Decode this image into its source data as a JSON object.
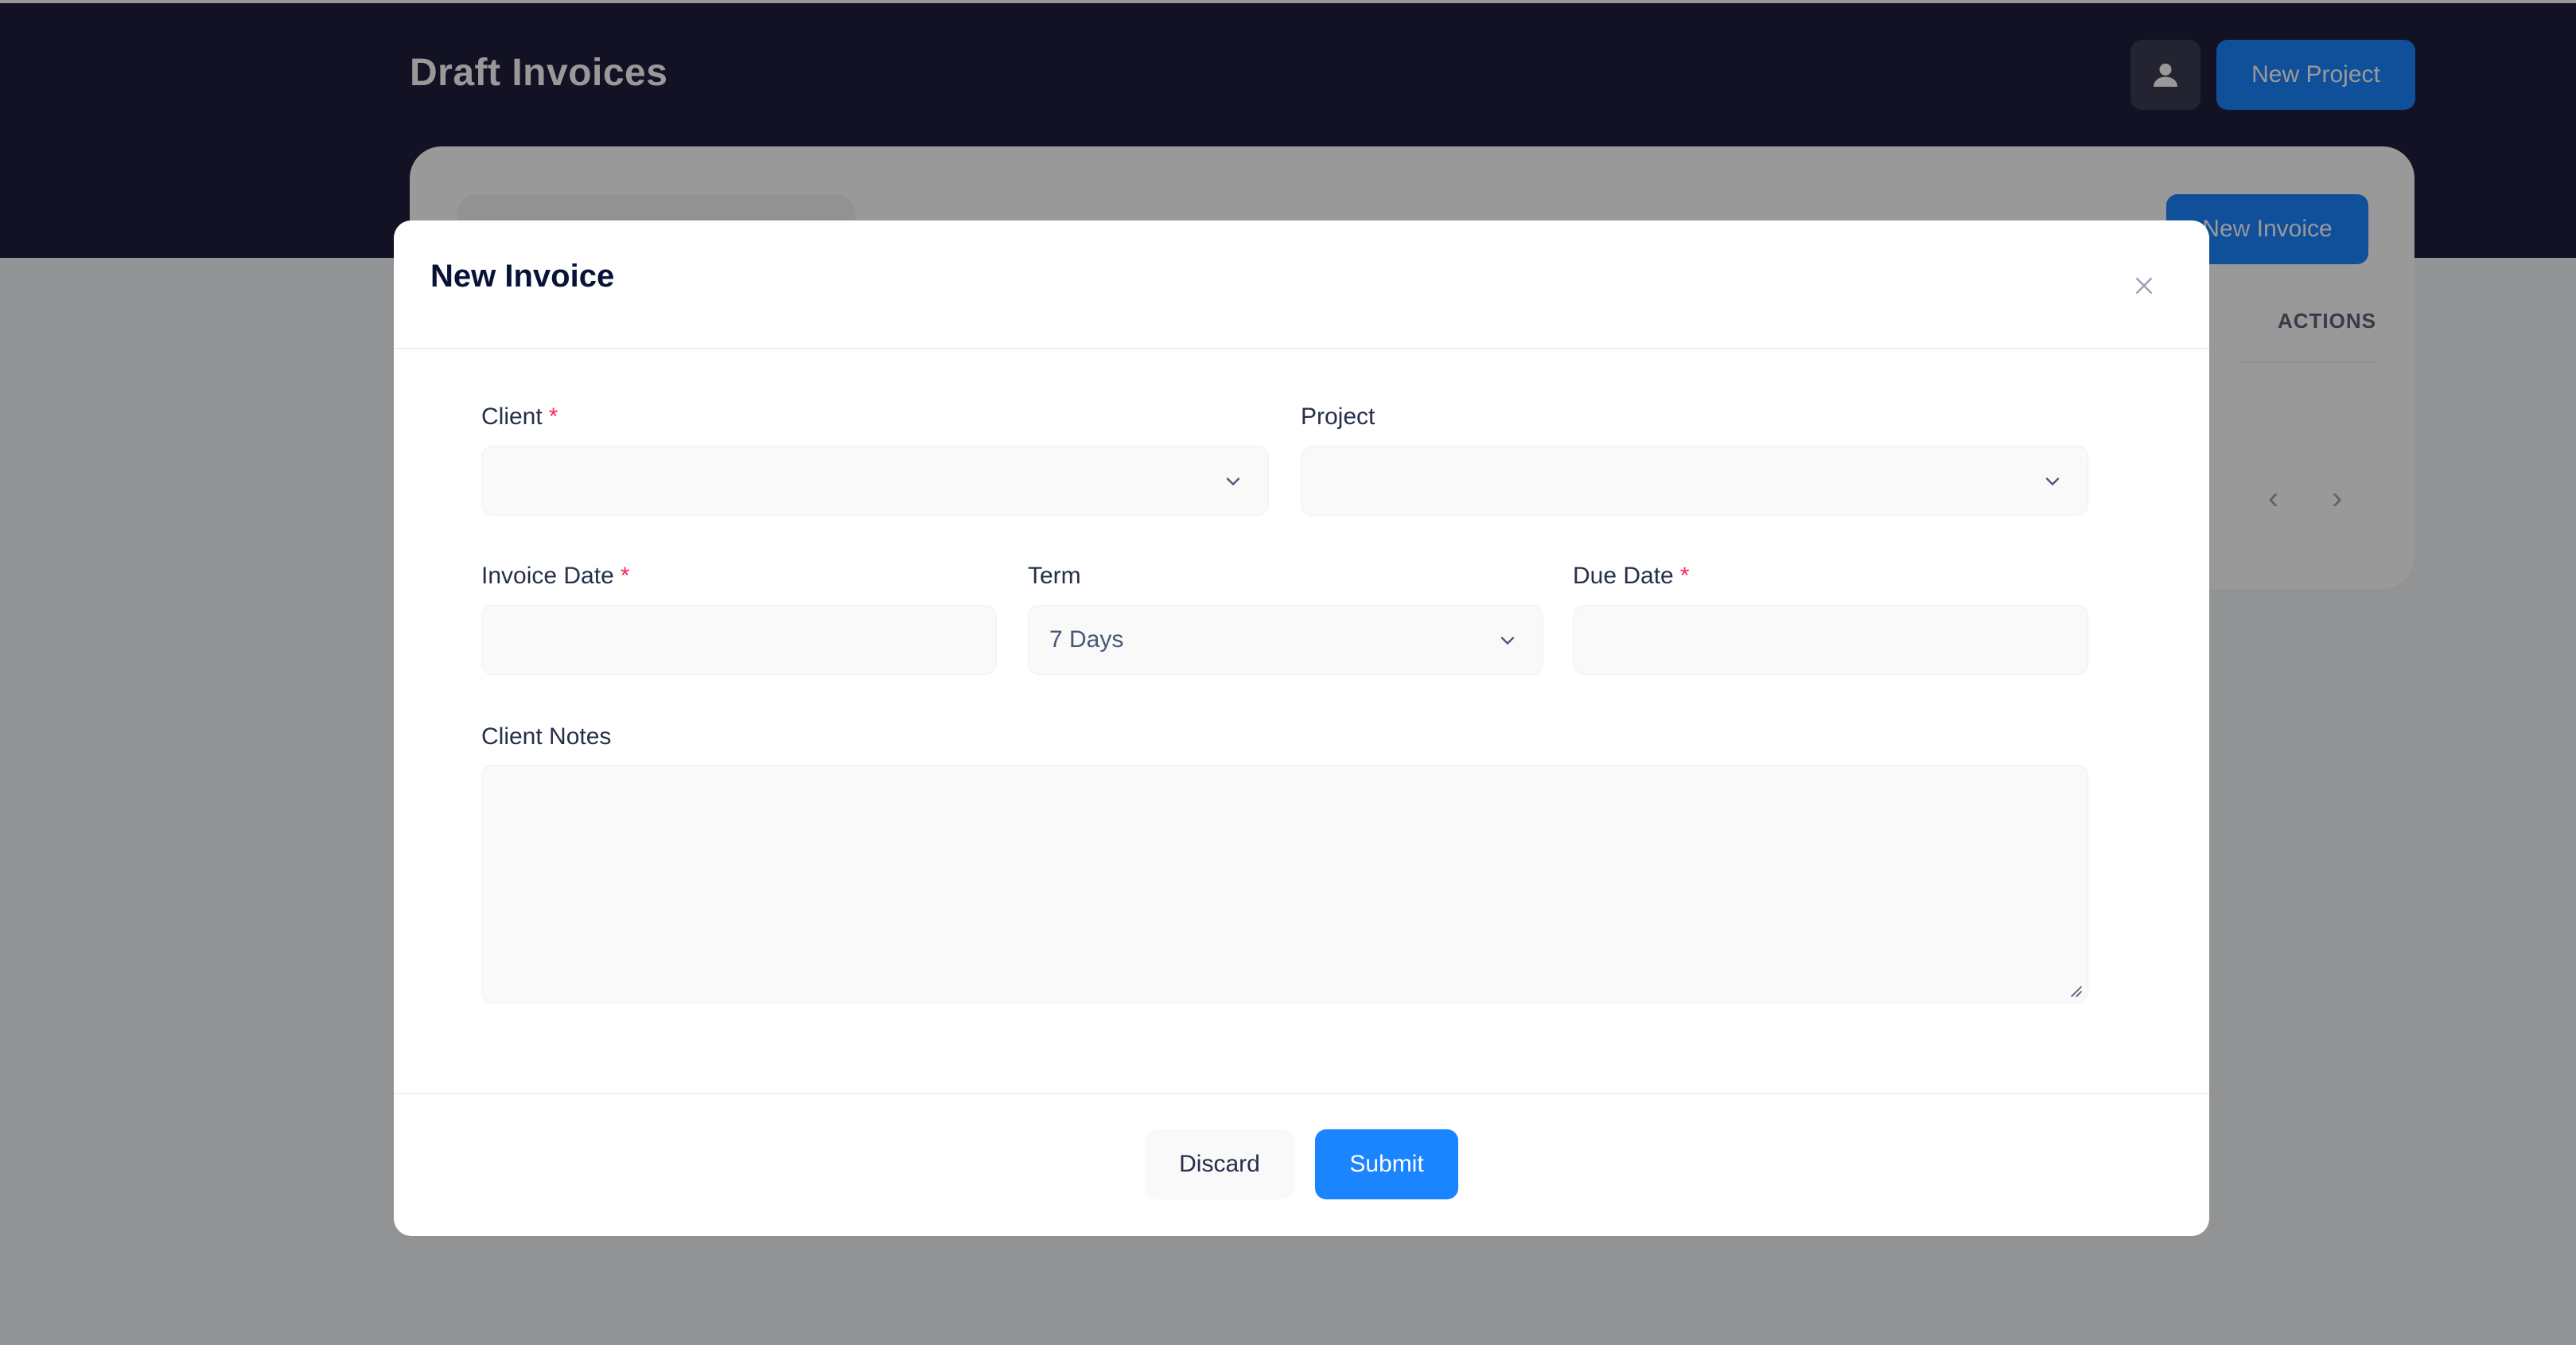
{
  "header": {
    "title": "Draft Invoices",
    "new_project_label": "New Project",
    "avatar_icon": "user-icon"
  },
  "background_card": {
    "new_invoice_label": "New Invoice",
    "actions_header": "ACTIONS",
    "prev_icon": "chevron-left-icon",
    "next_icon": "chevron-right-icon"
  },
  "modal": {
    "title": "New Invoice",
    "close_icon": "close-icon",
    "fields": {
      "client": {
        "label": "Client",
        "required_mark": "*",
        "value": ""
      },
      "project": {
        "label": "Project",
        "value": ""
      },
      "invoice_date": {
        "label": "Invoice Date",
        "required_mark": "*",
        "value": ""
      },
      "term": {
        "label": "Term",
        "value": "7 Days"
      },
      "due_date": {
        "label": "Due Date",
        "required_mark": "*",
        "value": ""
      },
      "client_notes": {
        "label": "Client Notes",
        "value": ""
      }
    },
    "footer": {
      "discard_label": "Discard",
      "submit_label": "Submit"
    }
  },
  "colors": {
    "header_bg": "#1e1e3c",
    "primary": "#1b84ff",
    "required": "#f8285a",
    "field_bg": "#f9f9f9"
  }
}
